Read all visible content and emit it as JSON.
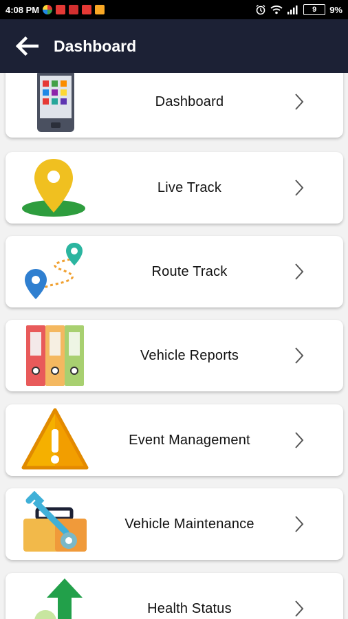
{
  "status_bar": {
    "time": "4:08 PM",
    "battery_level": "9",
    "battery_percent": "9%"
  },
  "app_bar": {
    "back_icon": "arrow-left-icon",
    "title": "Dashboard"
  },
  "menu": [
    {
      "label": "Dashboard",
      "icon": "phone-apps-icon"
    },
    {
      "label": "Live Track",
      "icon": "map-pin-icon"
    },
    {
      "label": "Route Track",
      "icon": "route-icon"
    },
    {
      "label": "Vehicle Reports",
      "icon": "binders-icon"
    },
    {
      "label": "Event Management",
      "icon": "warning-icon"
    },
    {
      "label": "Vehicle Maintenance",
      "icon": "toolbox-wrench-icon"
    },
    {
      "label": "Health Status",
      "icon": "up-arrow-icon"
    }
  ],
  "colors": {
    "app_bar_bg": "#1c2135",
    "page_bg": "#f2f2f2",
    "pin_yellow": "#f0c020",
    "pin_green": "#2e9d3e"
  }
}
